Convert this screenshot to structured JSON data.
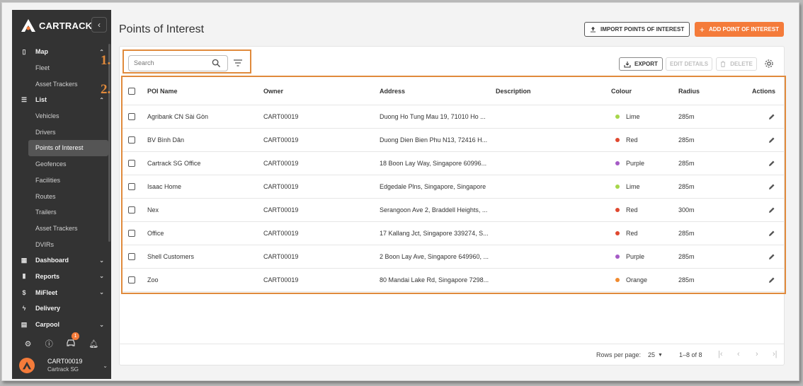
{
  "app": {
    "brand": "CARTRACK",
    "collapse_icon": "chevron-left-icon"
  },
  "sidebar": {
    "items": [
      {
        "label": "Map",
        "icon": "map-icon",
        "type": "top",
        "chevron": "up"
      },
      {
        "label": "Fleet",
        "type": "sub"
      },
      {
        "label": "Asset Trackers",
        "type": "sub"
      },
      {
        "label": "List",
        "icon": "list-icon",
        "type": "top",
        "chevron": "up"
      },
      {
        "label": "Vehicles",
        "type": "sub"
      },
      {
        "label": "Drivers",
        "type": "sub"
      },
      {
        "label": "Points of Interest",
        "type": "sub",
        "active": true
      },
      {
        "label": "Geofences",
        "type": "sub"
      },
      {
        "label": "Facilities",
        "type": "sub"
      },
      {
        "label": "Routes",
        "type": "sub"
      },
      {
        "label": "Trailers",
        "type": "sub"
      },
      {
        "label": "Asset Trackers",
        "type": "sub"
      },
      {
        "label": "DVIRs",
        "type": "sub"
      },
      {
        "label": "Dashboard",
        "icon": "dashboard-icon",
        "type": "top",
        "chevron": "down"
      },
      {
        "label": "Reports",
        "icon": "bar-chart-icon",
        "type": "top",
        "chevron": "down"
      },
      {
        "label": "MiFleet",
        "icon": "dollar-icon",
        "type": "top",
        "chevron": "down"
      },
      {
        "label": "Delivery",
        "icon": "bolt-icon",
        "type": "top"
      },
      {
        "label": "Carpool",
        "icon": "calendar-icon",
        "type": "top",
        "chevron": "down"
      }
    ],
    "bottom_icons": [
      "settings-icon",
      "help-icon",
      "car-alert-icon",
      "bell-icon"
    ],
    "notification_count": "1",
    "user": {
      "account": "CART00019",
      "company": "Cartrack SG"
    }
  },
  "header": {
    "title": "Points of Interest",
    "import_label": "IMPORT POINTS OF INTEREST",
    "add_label": "ADD POINT OF INTEREST"
  },
  "toolbar": {
    "search_placeholder": "Search",
    "export_label": "EXPORT",
    "edit_label": "EDIT DETAILS",
    "delete_label": "DELETE"
  },
  "annotations": {
    "one": "1.",
    "two": "2."
  },
  "table": {
    "columns": {
      "name": "POI Name",
      "owner": "Owner",
      "address": "Address",
      "description": "Description",
      "colour": "Colour",
      "radius": "Radius",
      "actions": "Actions"
    },
    "rows": [
      {
        "name": "Agribank CN Sài Gòn",
        "owner": "CART00019",
        "address": "Duong Ho Tung Mau 19, 71010 Ho ...",
        "description": "",
        "colour": "Lime",
        "hex": "#a6d64a",
        "radius": "285m"
      },
      {
        "name": "BV Bình Dân",
        "owner": "CART00019",
        "address": "Duong Dien Bien Phu N13, 72416 H...",
        "description": "",
        "colour": "Red",
        "hex": "#e0482f",
        "radius": "285m"
      },
      {
        "name": "Cartrack SG Office",
        "owner": "CART00019",
        "address": "18 Boon Lay Way, Singapore 60996...",
        "description": "",
        "colour": "Purple",
        "hex": "#a55bc6",
        "radius": "285m"
      },
      {
        "name": "Isaac Home",
        "owner": "CART00019",
        "address": "Edgedale Plns, Singapore, Singapore",
        "description": "",
        "colour": "Lime",
        "hex": "#a6d64a",
        "radius": "285m"
      },
      {
        "name": "Nex",
        "owner": "CART00019",
        "address": "Serangoon Ave 2, Braddell Heights, ...",
        "description": "",
        "colour": "Red",
        "hex": "#e0482f",
        "radius": "300m"
      },
      {
        "name": "Office",
        "owner": "CART00019",
        "address": "17 Kallang Jct, Singapore 339274, S...",
        "description": "",
        "colour": "Red",
        "hex": "#e0482f",
        "radius": "285m"
      },
      {
        "name": "Shell Customers",
        "owner": "CART00019",
        "address": "2 Boon Lay Ave, Singapore 649960, ...",
        "description": "",
        "colour": "Purple",
        "hex": "#a55bc6",
        "radius": "285m"
      },
      {
        "name": "Zoo",
        "owner": "CART00019",
        "address": "80 Mandai Lake Rd, Singapore 7298...",
        "description": "",
        "colour": "Orange",
        "hex": "#f08a2e",
        "radius": "285m"
      }
    ]
  },
  "pagination": {
    "rows_per_page_label": "Rows per page:",
    "rows_per_page": "25",
    "range": "1–8 of 8"
  },
  "colors": {
    "accent": "#f47b3a",
    "sidebar_bg": "#333333",
    "highlight": "#e08a3c"
  }
}
